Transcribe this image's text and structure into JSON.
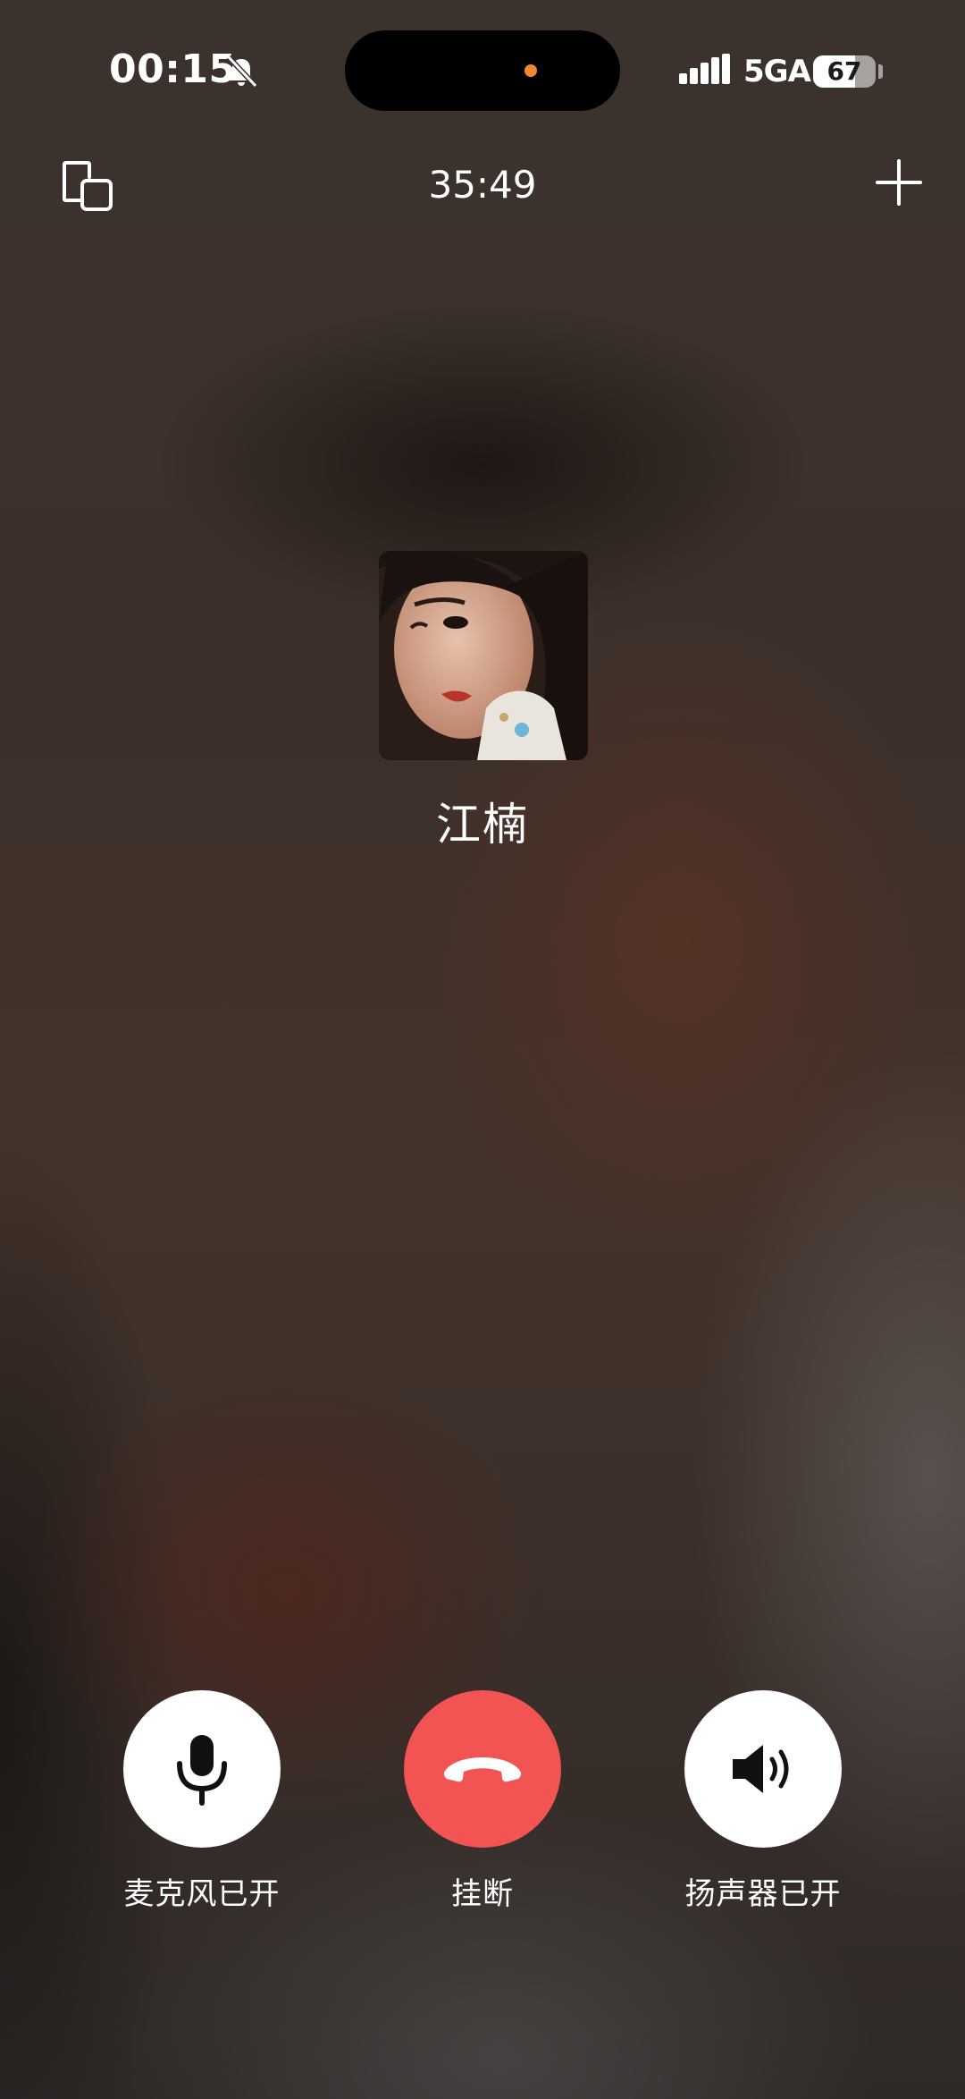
{
  "status_bar": {
    "time": "00:15",
    "network": "5GA",
    "battery_level": "67",
    "battery_fraction": 0.67
  },
  "call": {
    "duration": "35:49",
    "caller_name": "江楠"
  },
  "controls": {
    "mic_label": "麦克风已开",
    "hangup_label": "挂断",
    "speaker_label": "扬声器已开"
  },
  "colors": {
    "hangup": "#f25454",
    "island_dot": "#f08a2c"
  },
  "icons": [
    "bell-muted-icon",
    "signal-icon",
    "battery-icon",
    "minimize-window-icon",
    "add-icon",
    "microphone-icon",
    "phone-hangup-icon",
    "speaker-icon"
  ]
}
